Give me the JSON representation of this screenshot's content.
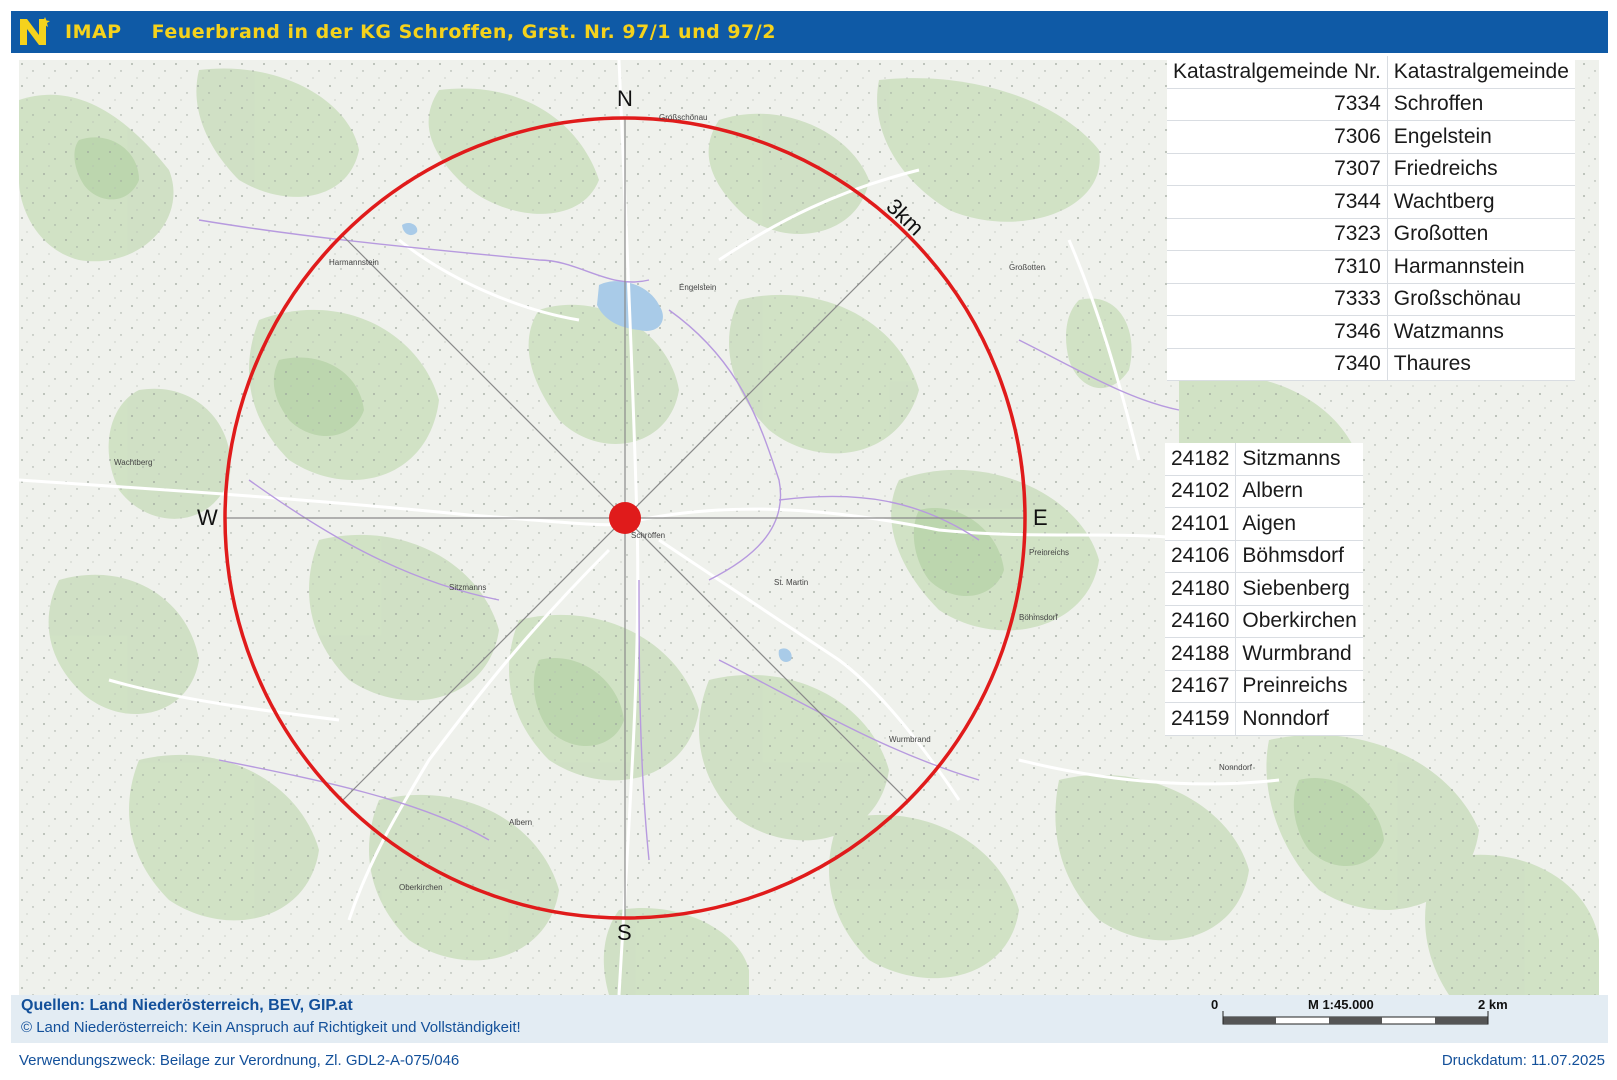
{
  "header": {
    "app_name": "IMAP",
    "title": "Feuerbrand in der KG Schroffen, Grst. Nr. 97/1 und 97/2",
    "background_color": "#0f5aa6",
    "text_color": "#f5d21c"
  },
  "map": {
    "compass": {
      "north": "N",
      "south": "S",
      "east": "E",
      "west": "W"
    },
    "radius_label": "3km",
    "circle_color": "#e01b1b",
    "center_marker_color": "#e01b1b",
    "place_labels": [
      "Großschönau",
      "Engelstein",
      "Harmannstein",
      "Wachtberg",
      "Großotten",
      "Sitzmanns",
      "Albern",
      "Oberkirchen",
      "St. Martin",
      "Wurmbrand",
      "Preinreichs",
      "Nonndorf",
      "Böhmsdorf",
      "Schroffen"
    ]
  },
  "table_upper": {
    "header": {
      "nr": "Katastralgemeinde Nr.",
      "name": "Katastralgemeinde"
    },
    "rows": [
      {
        "nr": "7334",
        "name": "Schroffen"
      },
      {
        "nr": "7306",
        "name": "Engelstein"
      },
      {
        "nr": "7307",
        "name": "Friedreichs"
      },
      {
        "nr": "7344",
        "name": "Wachtberg"
      },
      {
        "nr": "7323",
        "name": "Großotten"
      },
      {
        "nr": "7310",
        "name": "Harmannstein"
      },
      {
        "nr": "7333",
        "name": "Großschönau"
      },
      {
        "nr": "7346",
        "name": "Watzmanns"
      },
      {
        "nr": "7340",
        "name": "Thaures"
      }
    ]
  },
  "table_lower": {
    "rows": [
      {
        "nr": "24182",
        "name": "Sitzmanns"
      },
      {
        "nr": "24102",
        "name": "Albern"
      },
      {
        "nr": "24101",
        "name": "Aigen"
      },
      {
        "nr": "24106",
        "name": "Böhmsdorf"
      },
      {
        "nr": "24180",
        "name": "Siebenberg"
      },
      {
        "nr": "24160",
        "name": "Oberkirchen"
      },
      {
        "nr": "24188",
        "name": "Wurmbrand"
      },
      {
        "nr": "24167",
        "name": "Preinreichs"
      },
      {
        "nr": "24159",
        "name": "Nonndorf"
      }
    ]
  },
  "footer": {
    "sources": "Quellen: Land Niederösterreich, BEV, GIP.at",
    "disclaimer": "© Land Niederösterreich: Kein Anspruch auf Richtigkeit und Vollständigkeit!",
    "scale_start": "0",
    "scale_label": "M 1:45.000",
    "scale_end": "2 km",
    "purpose": "Verwendungszweck: Beilage zur Verordnung, Zl. GDL2-A-075/046",
    "print_date": "Druckdatum: 11.07.2025"
  }
}
